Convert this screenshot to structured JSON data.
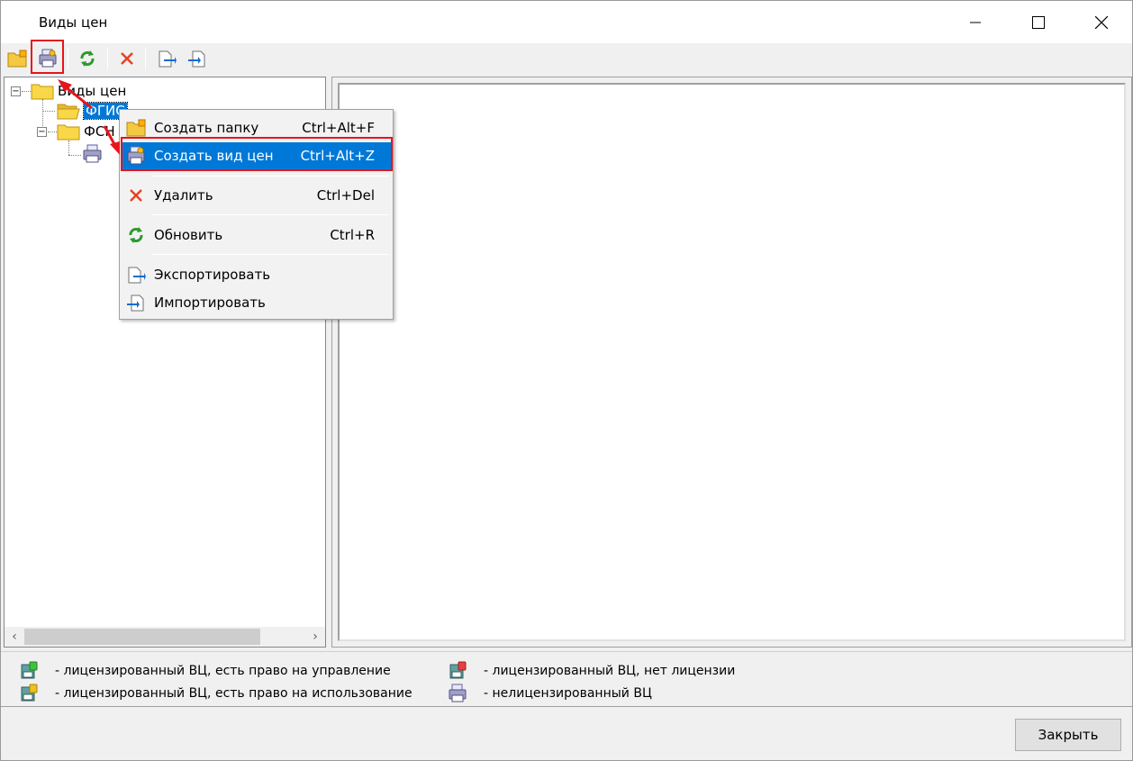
{
  "window": {
    "title": "Виды цен"
  },
  "tree": {
    "root": "Виды цен",
    "nodes": [
      {
        "label": "ФГИС"
      },
      {
        "label": "ФСН"
      }
    ]
  },
  "context_menu": {
    "items": [
      {
        "label": "Создать папку",
        "shortcut": "Ctrl+Alt+F"
      },
      {
        "label": "Создать вид цен",
        "shortcut": "Ctrl+Alt+Z"
      },
      {
        "label": "Удалить",
        "shortcut": "Ctrl+Del"
      },
      {
        "label": "Обновить",
        "shortcut": "Ctrl+R"
      },
      {
        "label": "Экспортировать",
        "shortcut": ""
      },
      {
        "label": "Импортировать",
        "shortcut": ""
      }
    ]
  },
  "legend": {
    "items": [
      {
        "text": "- лицензированный ВЦ, есть право на управление"
      },
      {
        "text": "- лицензированный ВЦ, есть право на использование"
      },
      {
        "text": "- лицензированный ВЦ, нет лицензии"
      },
      {
        "text": "- нелицензированный ВЦ"
      }
    ]
  },
  "footer": {
    "close_label": "Закрыть"
  },
  "colors": {
    "accent": "#0078d7",
    "highlight_red": "#e8141c"
  }
}
